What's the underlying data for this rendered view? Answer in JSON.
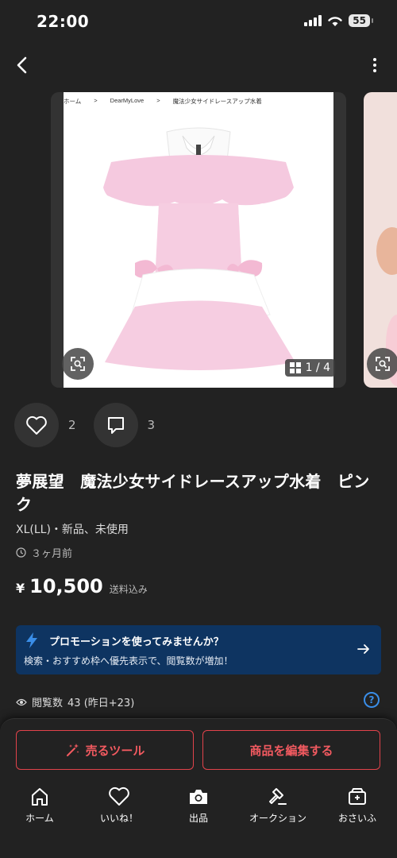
{
  "status_bar": {
    "time": "22:00",
    "battery": "55"
  },
  "breadcrumb": [
    "ホーム",
    ">",
    "DearMyLove",
    ">",
    "魔法少女サイドレースアップ水着"
  ],
  "gallery": {
    "counter": "1 / 4"
  },
  "actions": {
    "likes": "2",
    "comments": "3"
  },
  "item": {
    "title": "夢展望　魔法少女サイドレースアップ水着　ピンク",
    "condition": "XL(LL)・新品、未使用",
    "posted": "３ヶ月前",
    "currency": "¥",
    "price": "10,500",
    "shipping": "送料込み"
  },
  "promo": {
    "title": "プロモーションを使ってみませんか？",
    "subtitle": "検索・おすすめ枠へ優先表示で、閲覧数が増加！"
  },
  "stats": {
    "views_label": "閲覧数",
    "views_value": "43 (昨日+23)"
  },
  "buttons": {
    "sell_tool": "売るツール",
    "edit_item": "商品を編集する"
  },
  "tabbar": [
    {
      "label": "ホーム",
      "icon": "home-icon"
    },
    {
      "label": "いいね！",
      "icon": "heart-icon"
    },
    {
      "label": "出品",
      "icon": "camera-icon"
    },
    {
      "label": "オークション",
      "icon": "gavel-icon"
    },
    {
      "label": "おさいふ",
      "icon": "wallet-icon"
    }
  ],
  "colors": {
    "background": "#222222",
    "accent_red": "#e2434b",
    "promo_blue": "#0e3461",
    "help_blue": "#3a8ee8"
  }
}
